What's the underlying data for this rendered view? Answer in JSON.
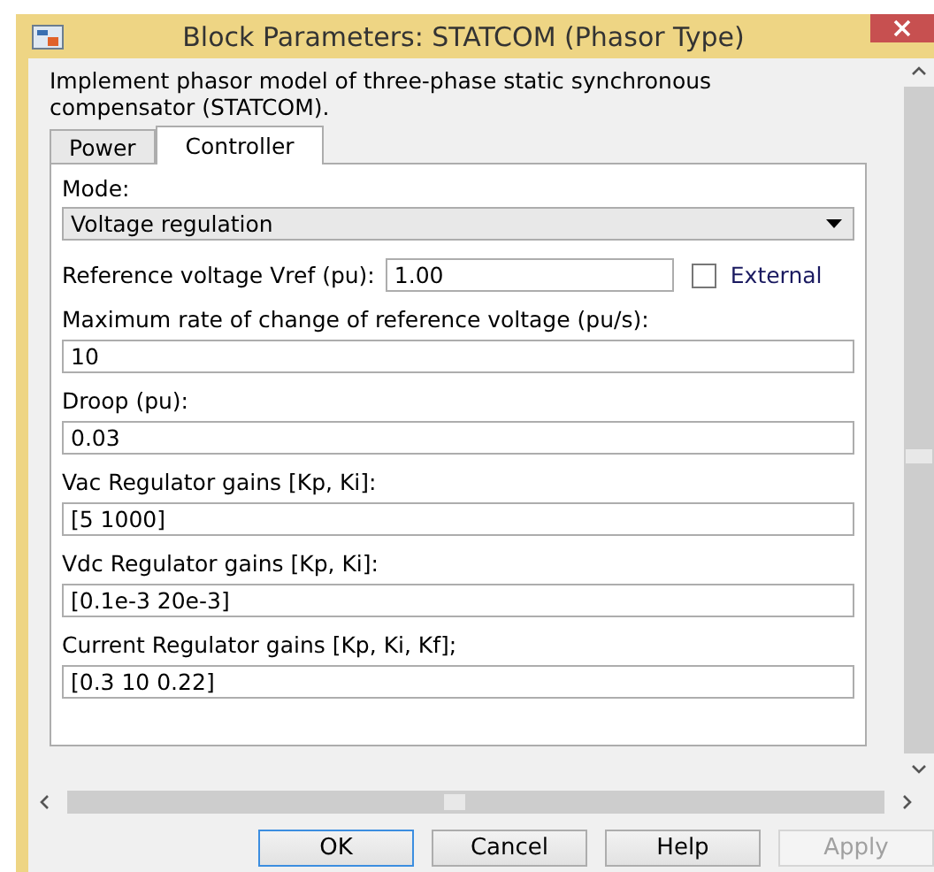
{
  "window": {
    "title": "Block Parameters: STATCOM (Phasor Type)"
  },
  "description": "Implement phasor model of three-phase static synchronous compensator (STATCOM).",
  "tabs": [
    {
      "label": "Power",
      "selected": false
    },
    {
      "label": "Controller",
      "selected": true
    }
  ],
  "mode": {
    "label": "Mode:",
    "value": "Voltage regulation"
  },
  "reference": {
    "label": "Reference voltage Vref (pu):",
    "value": "1.00"
  },
  "external": {
    "label": "External",
    "checked": false
  },
  "parameters": [
    {
      "label": "Maximum rate of change of reference voltage (pu/s):",
      "value": "10"
    },
    {
      "label": "Droop (pu):",
      "value": "0.03"
    },
    {
      "label": "Vac Regulator gains [Kp, Ki]:",
      "value": "[5 1000]"
    },
    {
      "label": "Vdc Regulator gains [Kp, Ki]:",
      "value": "[0.1e-3 20e-3]"
    },
    {
      "label": "Current Regulator gains [Kp, Ki, Kf];",
      "value": "[0.3 10 0.22]"
    }
  ],
  "buttons": [
    {
      "label": "OK",
      "disabled": false,
      "default": true
    },
    {
      "label": "Cancel",
      "disabled": false,
      "default": false
    },
    {
      "label": "Help",
      "disabled": false,
      "default": false
    },
    {
      "label": "Apply",
      "disabled": true,
      "default": false
    }
  ]
}
